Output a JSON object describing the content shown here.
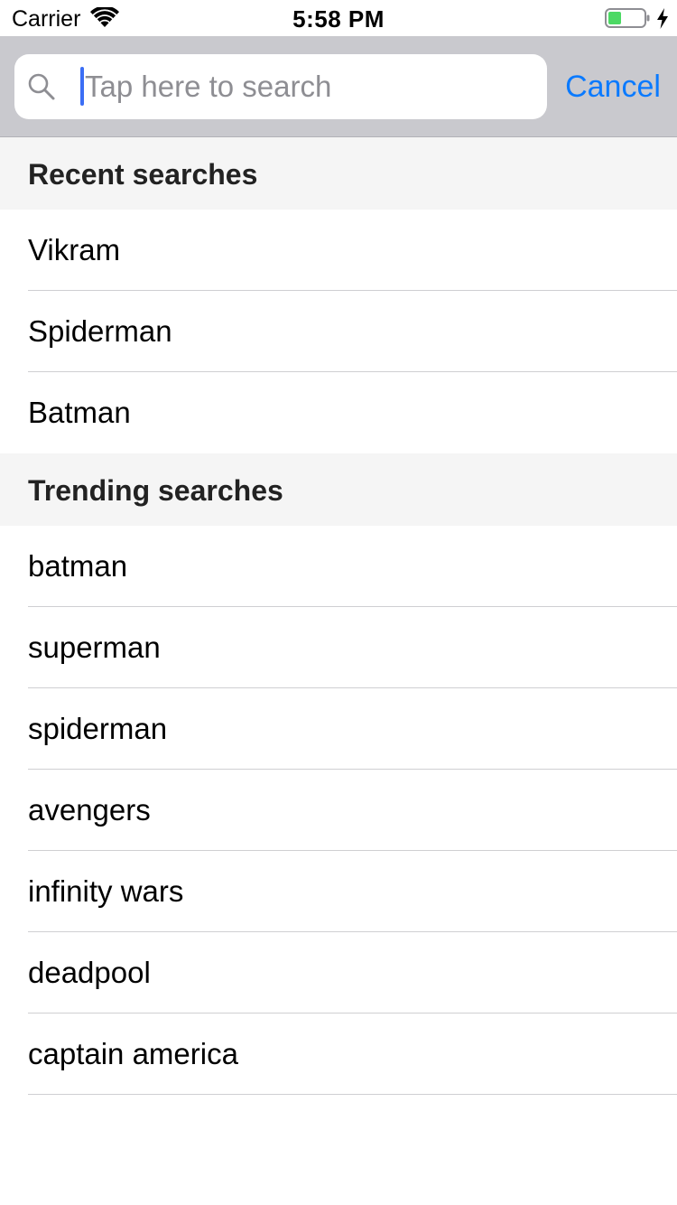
{
  "status_bar": {
    "carrier": "Carrier",
    "time": "5:58 PM",
    "icons": [
      "wifi-icon",
      "battery-icon",
      "charging-bolt-icon"
    ],
    "battery_color": "#4cd964"
  },
  "search": {
    "placeholder": "Tap here to search",
    "value": "",
    "cancel_label": "Cancel",
    "icon": "search-icon",
    "accent_color": "#0a7aff"
  },
  "recent": {
    "title": "Recent searches",
    "items": [
      "Vikram",
      "Spiderman",
      "Batman"
    ]
  },
  "trending": {
    "title": "Trending searches",
    "items": [
      "batman",
      "superman",
      "spiderman",
      "avengers",
      "infinity wars",
      "deadpool",
      "captain america"
    ]
  }
}
